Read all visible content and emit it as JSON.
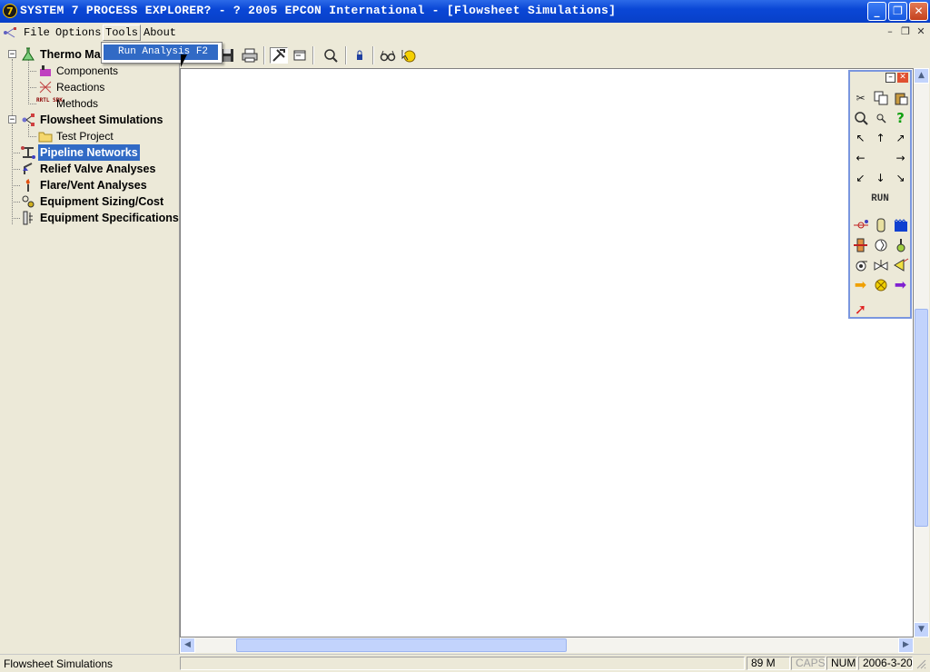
{
  "window": {
    "app_icon_glyph": "7",
    "title": "SYSTEM 7 PROCESS EXPLORER? - ? 2005 EPCON International - [Flowsheet Simulations]",
    "minimize_glyph": "_",
    "maximize_glyph": "❐",
    "close_glyph": "✕"
  },
  "menubar": {
    "items": [
      "File",
      "Options",
      "Tools",
      "About"
    ],
    "active": "Tools",
    "mdi_minimize": "–",
    "mdi_restore": "❐",
    "mdi_close": "✕"
  },
  "dropdown": {
    "item_label": "Run Analysis",
    "item_shortcut": "F2"
  },
  "tree": {
    "items": [
      {
        "label": "Thermo Manager",
        "bold": true,
        "icon": "flask-icon"
      },
      {
        "label": "Components",
        "icon": "components-icon"
      },
      {
        "label": "Reactions",
        "icon": "reactions-icon"
      },
      {
        "label": "Methods",
        "icon": "methods-icon"
      },
      {
        "label": "Flowsheet Simulations",
        "bold": true,
        "icon": "flowsheet-icon"
      },
      {
        "label": "Test Project",
        "icon": "folder-icon"
      },
      {
        "label": "Pipeline Networks",
        "bold": true,
        "selected": true,
        "icon": "pipeline-icon"
      },
      {
        "label": "Relief Valve Analyses",
        "bold": true,
        "icon": "relief-valve-icon"
      },
      {
        "label": "Flare/Vent Analyses",
        "bold": true,
        "icon": "flare-icon"
      },
      {
        "label": "Equipment Sizing/Cost",
        "bold": true,
        "icon": "sizing-icon"
      },
      {
        "label": "Equipment Specifications",
        "bold": true,
        "icon": "spec-icon"
      }
    ],
    "methods_icon_text": "RRTL SRK"
  },
  "toolbar": {
    "icons": [
      "save-icon",
      "print-icon",
      "tools-icon",
      "window-icon",
      "zoom-icon",
      "lock-icon",
      "glasses-icon",
      "help-cursor-icon"
    ]
  },
  "palette": {
    "run_label": "RUN"
  },
  "statusbar": {
    "message": "Flowsheet Simulations",
    "memory": "89 M",
    "caps": "CAPS",
    "num": "NUM",
    "date": "2006-3-20"
  },
  "colors": {
    "titlebar": "#0A47D6",
    "selection": "#316AC5",
    "face": "#ECE9D8"
  }
}
